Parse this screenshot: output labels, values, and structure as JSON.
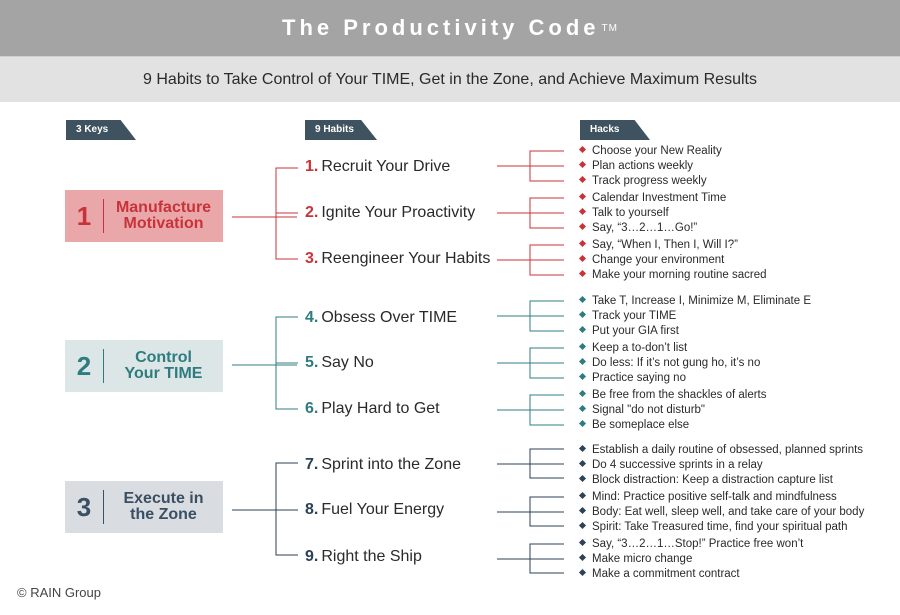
{
  "header": {
    "title": "The Productivity Code",
    "trademark": "TM",
    "subtitle": "9 Habits to Take Control of Your TIME, Get in the Zone, and Achieve Maximum Results"
  },
  "columns": {
    "keys": "3 Keys",
    "habits": "9 Habits",
    "hacks": "Hacks"
  },
  "colors": {
    "red": "#c8333a",
    "teal": "#2f7c80",
    "navy": "#2c4256",
    "header_gray": "#a4a4a4"
  },
  "keys": [
    {
      "number": "1",
      "label_line1": "Manufacture",
      "label_line2": "Motivation",
      "habits": [
        {
          "number": "1.",
          "title": "Recruit Your Drive",
          "hacks": [
            "Choose your New Reality",
            "Plan actions weekly",
            "Track progress weekly"
          ]
        },
        {
          "number": "2.",
          "title": "Ignite Your Proactivity",
          "hacks": [
            "Calendar Investment Time",
            "Talk to yourself",
            "Say, “3…2…1…Go!”"
          ]
        },
        {
          "number": "3.",
          "title": "Reengineer Your Habits",
          "hacks": [
            "Say, “When I, Then I, Will I?”",
            "Change your environment",
            "Make your morning routine sacred"
          ]
        }
      ]
    },
    {
      "number": "2",
      "label_line1": "Control",
      "label_line2": "Your TIME",
      "habits": [
        {
          "number": "4.",
          "title": "Obsess Over TIME",
          "hacks": [
            "Take T, Increase I, Minimize M, Eliminate E",
            "Track your TIME",
            "Put your GIA first"
          ]
        },
        {
          "number": "5.",
          "title": "Say No",
          "hacks": [
            "Keep a to-don’t list",
            "Do less: If it’s not gung ho, it’s no",
            "Practice saying no"
          ]
        },
        {
          "number": "6.",
          "title": "Play Hard to Get",
          "hacks": [
            "Be free from the shackles of alerts",
            "Signal \"do not disturb\"",
            "Be someplace else"
          ]
        }
      ]
    },
    {
      "number": "3",
      "label_line1": "Execute in",
      "label_line2": "the Zone",
      "habits": [
        {
          "number": "7.",
          "title": "Sprint into the Zone",
          "hacks": [
            "Establish a daily routine of obsessed, planned sprints",
            "Do 4 successive sprints in a relay",
            "Block distraction: Keep a distraction capture list"
          ]
        },
        {
          "number": "8.",
          "title": "Fuel Your Energy",
          "hacks": [
            "Mind: Practice positive self-talk and mindfulness",
            "Body: Eat well, sleep well, and take care of your body",
            "Spirit: Take Treasured time, find your spiritual path"
          ]
        },
        {
          "number": "9.",
          "title": "Right the Ship",
          "hacks": [
            "Say, “3…2…1…Stop!” Practice free won’t",
            "Make micro change",
            "Make a commitment contract"
          ]
        }
      ]
    }
  ],
  "footer": {
    "copyright": "© RAIN Group"
  }
}
